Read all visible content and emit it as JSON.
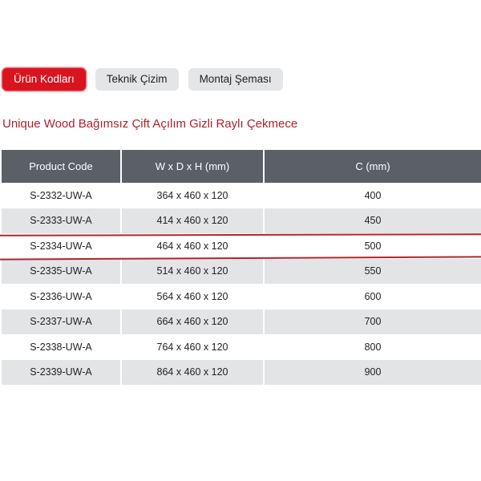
{
  "tabs": [
    {
      "label": "Ürün Kodları",
      "active": true
    },
    {
      "label": "Teknik Çizim",
      "active": false
    },
    {
      "label": "Montaj Şeması",
      "active": false
    }
  ],
  "title": "Unique Wood Bağımsız Çift Açılım Gizli Raylı Çekmece",
  "table": {
    "headers": [
      "Product Code",
      "W x D x H (mm)",
      "C (mm)"
    ],
    "rows": [
      [
        "S-2332-UW-A",
        "364 x 460 x 120",
        "400"
      ],
      [
        "S-2333-UW-A",
        "414 x 460 x 120",
        "450"
      ],
      [
        "S-2334-UW-A",
        "464 x 460 x 120",
        "500"
      ],
      [
        "S-2335-UW-A",
        "514 x 460 x 120",
        "550"
      ],
      [
        "S-2336-UW-A",
        "564 x 460 x 120",
        "600"
      ],
      [
        "S-2337-UW-A",
        "664 x 460 x 120",
        "700"
      ],
      [
        "S-2338-UW-A",
        "764 x 460 x 120",
        "800"
      ],
      [
        "S-2339-UW-A",
        "864 x 460 x 120",
        "900"
      ]
    ]
  },
  "colors": {
    "active_tab": "#d8151f",
    "title": "#b0202a",
    "header_bg": "#5b6066",
    "row_alt_bg": "#e3e4e6",
    "highlight_line": "#b3242d"
  }
}
